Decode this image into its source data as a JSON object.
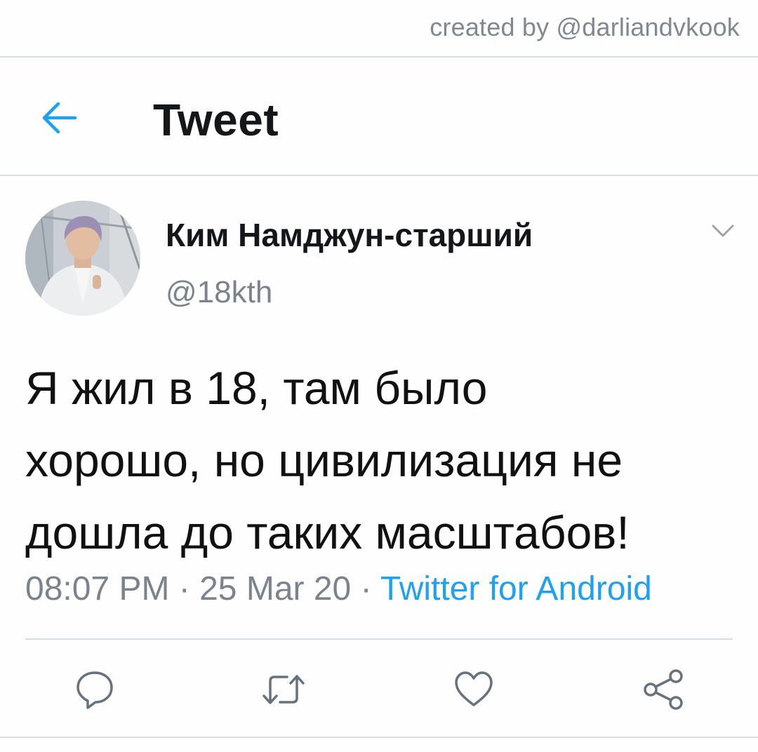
{
  "credit": {
    "text": "created by @darliandvkook"
  },
  "header": {
    "title": "Tweet",
    "back_icon": "arrow-left-icon"
  },
  "author": {
    "name": "Ким Намджун-старший",
    "handle": "@18kth",
    "avatar": "avatar-photo"
  },
  "tweet": {
    "lines": [
      "Я жил в 18, там было",
      "хорошо, но цивилизация не",
      "дошла до таких масштабов!"
    ]
  },
  "meta": {
    "time": "08:07 PM",
    "sep1": " · ",
    "date": "25 Mar 20",
    "sep2": " · ",
    "source": "Twitter for Android"
  },
  "actions": [
    {
      "icon": "reply-icon"
    },
    {
      "icon": "retweet-icon"
    },
    {
      "icon": "like-icon"
    },
    {
      "icon": "share-icon"
    }
  ],
  "colors": {
    "accent": "#1ea1f2",
    "muted_text": "#7b848d",
    "divider": "#d9dde1",
    "icon_stroke": "#66727d"
  }
}
